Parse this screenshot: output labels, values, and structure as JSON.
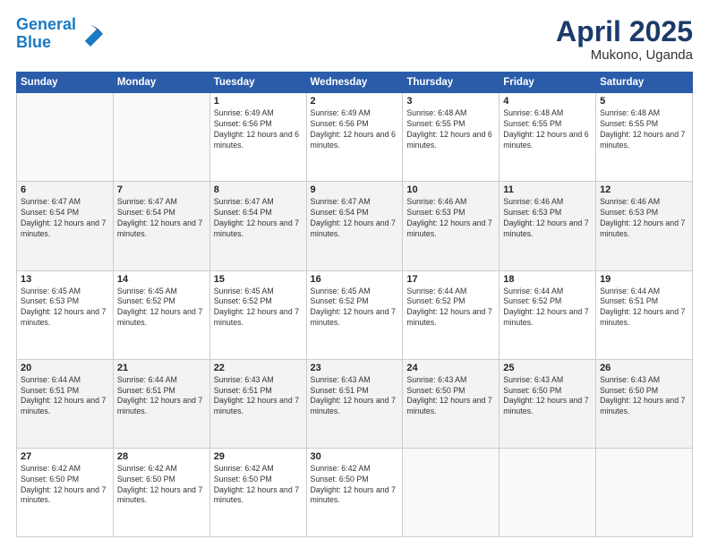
{
  "header": {
    "logo_line1": "General",
    "logo_line2": "Blue",
    "title": "April 2025",
    "subtitle": "Mukono, Uganda"
  },
  "weekdays": [
    "Sunday",
    "Monday",
    "Tuesday",
    "Wednesday",
    "Thursday",
    "Friday",
    "Saturday"
  ],
  "weeks": [
    [
      {
        "day": "",
        "info": ""
      },
      {
        "day": "",
        "info": ""
      },
      {
        "day": "1",
        "info": "Sunrise: 6:49 AM\nSunset: 6:56 PM\nDaylight: 12 hours\nand 6 minutes."
      },
      {
        "day": "2",
        "info": "Sunrise: 6:49 AM\nSunset: 6:56 PM\nDaylight: 12 hours\nand 6 minutes."
      },
      {
        "day": "3",
        "info": "Sunrise: 6:48 AM\nSunset: 6:55 PM\nDaylight: 12 hours\nand 6 minutes."
      },
      {
        "day": "4",
        "info": "Sunrise: 6:48 AM\nSunset: 6:55 PM\nDaylight: 12 hours\nand 6 minutes."
      },
      {
        "day": "5",
        "info": "Sunrise: 6:48 AM\nSunset: 6:55 PM\nDaylight: 12 hours\nand 7 minutes."
      }
    ],
    [
      {
        "day": "6",
        "info": "Sunrise: 6:47 AM\nSunset: 6:54 PM\nDaylight: 12 hours\nand 7 minutes."
      },
      {
        "day": "7",
        "info": "Sunrise: 6:47 AM\nSunset: 6:54 PM\nDaylight: 12 hours\nand 7 minutes."
      },
      {
        "day": "8",
        "info": "Sunrise: 6:47 AM\nSunset: 6:54 PM\nDaylight: 12 hours\nand 7 minutes."
      },
      {
        "day": "9",
        "info": "Sunrise: 6:47 AM\nSunset: 6:54 PM\nDaylight: 12 hours\nand 7 minutes."
      },
      {
        "day": "10",
        "info": "Sunrise: 6:46 AM\nSunset: 6:53 PM\nDaylight: 12 hours\nand 7 minutes."
      },
      {
        "day": "11",
        "info": "Sunrise: 6:46 AM\nSunset: 6:53 PM\nDaylight: 12 hours\nand 7 minutes."
      },
      {
        "day": "12",
        "info": "Sunrise: 6:46 AM\nSunset: 6:53 PM\nDaylight: 12 hours\nand 7 minutes."
      }
    ],
    [
      {
        "day": "13",
        "info": "Sunrise: 6:45 AM\nSunset: 6:53 PM\nDaylight: 12 hours\nand 7 minutes."
      },
      {
        "day": "14",
        "info": "Sunrise: 6:45 AM\nSunset: 6:52 PM\nDaylight: 12 hours\nand 7 minutes."
      },
      {
        "day": "15",
        "info": "Sunrise: 6:45 AM\nSunset: 6:52 PM\nDaylight: 12 hours\nand 7 minutes."
      },
      {
        "day": "16",
        "info": "Sunrise: 6:45 AM\nSunset: 6:52 PM\nDaylight: 12 hours\nand 7 minutes."
      },
      {
        "day": "17",
        "info": "Sunrise: 6:44 AM\nSunset: 6:52 PM\nDaylight: 12 hours\nand 7 minutes."
      },
      {
        "day": "18",
        "info": "Sunrise: 6:44 AM\nSunset: 6:52 PM\nDaylight: 12 hours\nand 7 minutes."
      },
      {
        "day": "19",
        "info": "Sunrise: 6:44 AM\nSunset: 6:51 PM\nDaylight: 12 hours\nand 7 minutes."
      }
    ],
    [
      {
        "day": "20",
        "info": "Sunrise: 6:44 AM\nSunset: 6:51 PM\nDaylight: 12 hours\nand 7 minutes."
      },
      {
        "day": "21",
        "info": "Sunrise: 6:44 AM\nSunset: 6:51 PM\nDaylight: 12 hours\nand 7 minutes."
      },
      {
        "day": "22",
        "info": "Sunrise: 6:43 AM\nSunset: 6:51 PM\nDaylight: 12 hours\nand 7 minutes."
      },
      {
        "day": "23",
        "info": "Sunrise: 6:43 AM\nSunset: 6:51 PM\nDaylight: 12 hours\nand 7 minutes."
      },
      {
        "day": "24",
        "info": "Sunrise: 6:43 AM\nSunset: 6:50 PM\nDaylight: 12 hours\nand 7 minutes."
      },
      {
        "day": "25",
        "info": "Sunrise: 6:43 AM\nSunset: 6:50 PM\nDaylight: 12 hours\nand 7 minutes."
      },
      {
        "day": "26",
        "info": "Sunrise: 6:43 AM\nSunset: 6:50 PM\nDaylight: 12 hours\nand 7 minutes."
      }
    ],
    [
      {
        "day": "27",
        "info": "Sunrise: 6:42 AM\nSunset: 6:50 PM\nDaylight: 12 hours\nand 7 minutes."
      },
      {
        "day": "28",
        "info": "Sunrise: 6:42 AM\nSunset: 6:50 PM\nDaylight: 12 hours\nand 7 minutes."
      },
      {
        "day": "29",
        "info": "Sunrise: 6:42 AM\nSunset: 6:50 PM\nDaylight: 12 hours\nand 7 minutes."
      },
      {
        "day": "30",
        "info": "Sunrise: 6:42 AM\nSunset: 6:50 PM\nDaylight: 12 hours\nand 7 minutes."
      },
      {
        "day": "",
        "info": ""
      },
      {
        "day": "",
        "info": ""
      },
      {
        "day": "",
        "info": ""
      }
    ]
  ]
}
